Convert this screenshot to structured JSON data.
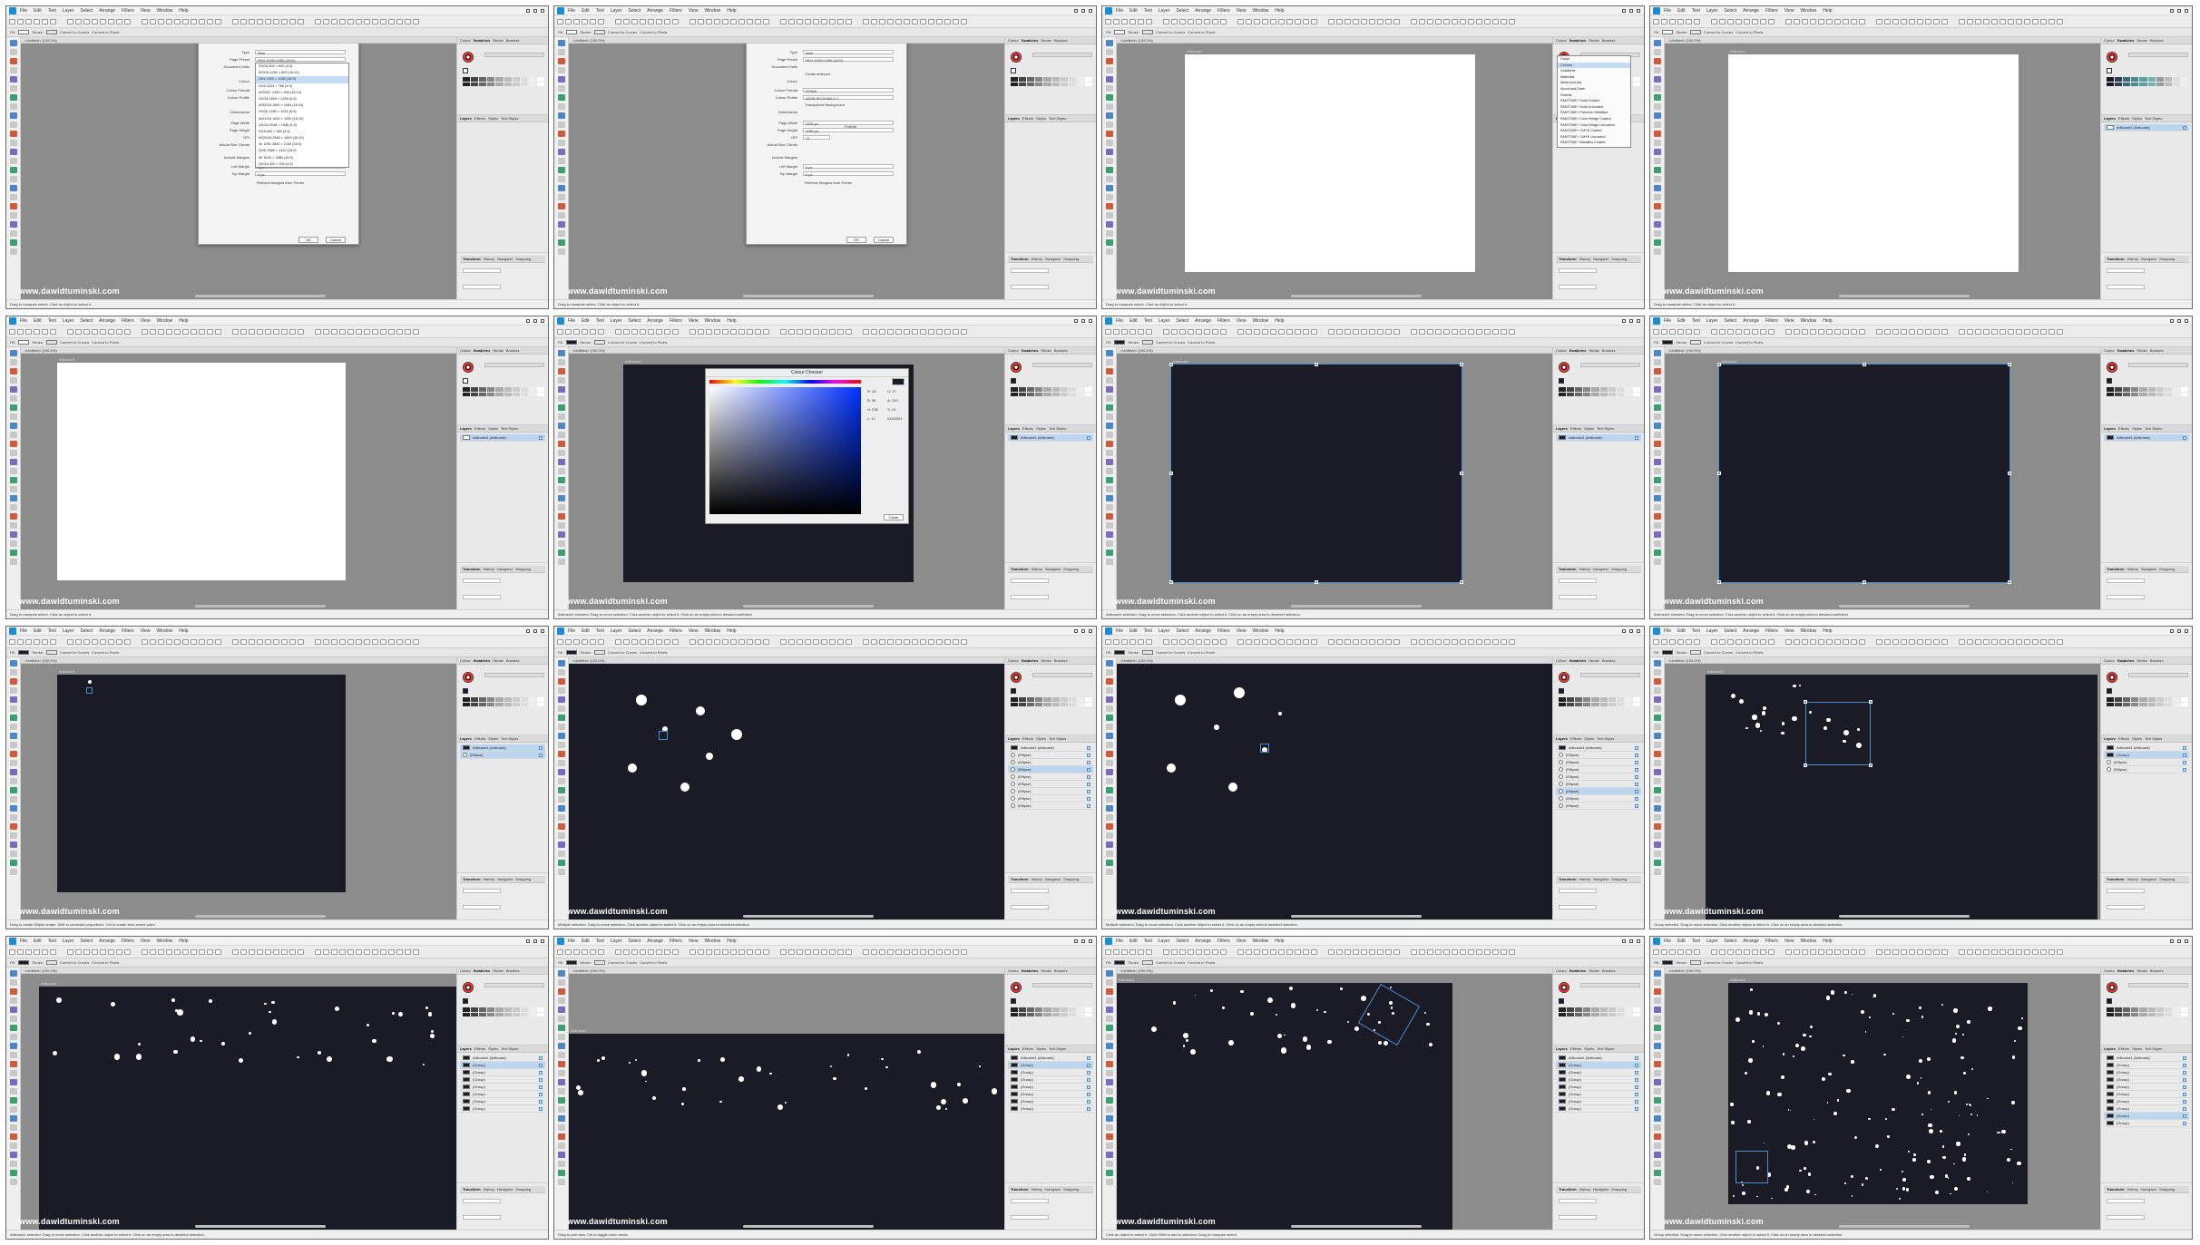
{
  "app": {
    "menus": [
      "File",
      "Edit",
      "Text",
      "Layer",
      "Select",
      "Arrange",
      "Filters",
      "View",
      "Window",
      "Help"
    ],
    "watermark": "www.dawidtuminski.com",
    "document_tab": "<Untitled> (100.0%)",
    "artboard_label": "Artboard1",
    "panel_tabs": [
      "Colour",
      "Swatches",
      "Stroke",
      "Brushes"
    ],
    "layers_tabs": [
      "Layers",
      "Effects",
      "Styles",
      "Text Styles"
    ],
    "transform_tabs": [
      "Transform",
      "History",
      "Navigator",
      "Snapping"
    ]
  },
  "colors": {
    "artboard_dark": "#1a1b24",
    "selection": "#4a8bd1",
    "canvas_bg": "#8c8c8c"
  },
  "new_document_dialog": {
    "title": "New Document",
    "labels": {
      "type": "Type",
      "page_preset": "Page Preset",
      "document_units": "Document Units",
      "colour": "Colour",
      "colour_format": "Colour Format",
      "colour_profile": "Colour Profile",
      "dimensions": "Dimensions",
      "page_width": "Page Width",
      "page_height": "Page Height",
      "dpi": "DPI",
      "about_size": "Actual Size Clients",
      "margins": "Include Margins",
      "left_margin": "Left Margin",
      "right_margin": "Right Margin",
      "top_margin": "Top Margin",
      "bottom_margin": "Bottom Margin",
      "retrieve": "Retrieve Margins from Printer",
      "create_artboard": "Create artboard",
      "transparent": "Transparent Background",
      "portrait": "Portrait"
    },
    "values": {
      "type": "Web",
      "page_preset": "HD4 1920×1080 (16:9)",
      "colour_format": "RGB/8",
      "colour_profile": "sRGB IEC61966-2.1",
      "page_width": "1920 px",
      "page_height": "1080 px",
      "dpi": "72",
      "margin": "0 px"
    },
    "preset_list": [
      "SVGA 800 × 600 (4:3)",
      "WXGA 1280 × 800 (16:10)",
      "HD4 1920 × 1080 (16:9)",
      "XGA 1024 × 768 (4:3)",
      "WXGA+ 1440 × 900 (16:10)",
      "UXGA 1600 × 1200 (4:3)",
      "WSXGA 1680 × 1050 (16:10)",
      "SXGA 1280 × 1024 (5:4)",
      "WUXGA 1920 × 1200 (16:10)",
      "QXGA 2048 × 1536 (4:3)",
      "VGA 640 × 480 (4:3)",
      "WQXGA 2560 × 1600 (16:10)",
      "4K UHD 3840 × 2160 (16:9)",
      "QHD 2560 × 1440 (16:9)",
      "5K 5120 × 2880 (16:9)",
      "QVGA 320 × 240 (4:3)"
    ],
    "ok": "OK",
    "cancel": "Cancel"
  },
  "colour_picker": {
    "title": "Colour Chooser",
    "mode": "RGB",
    "fields": [
      "R: 26",
      "G: 27",
      "B: 36",
      "A: 100",
      "H: 235",
      "S: 14",
      "L: 12",
      "#1A1B24"
    ],
    "close": "Close"
  },
  "swatch_popup": {
    "items": [
      "Greys",
      "Colours",
      "Gradients",
      "Materials",
      "Metal and sky",
      "Wood and Earth",
      "Pastels",
      "PANTONE+ Solid Coated",
      "PANTONE+ Solid Uncoated",
      "PANTONE+ Premium Metallics",
      "PANTONE+ Color Bridge Coated",
      "PANTONE+ Color Bridge Uncoated",
      "PANTONE+ CMYK Coated",
      "PANTONE+ CMYK Uncoated",
      "PANTONE+ Metallics Coated"
    ]
  },
  "layers": {
    "artboard": "Artboard1 (Artboard)",
    "ellipse": "(Ellipse)",
    "group": "(Group)"
  },
  "context": {
    "fill": "Fill:",
    "stroke": "Stroke:",
    "convert_curves": "Convert to Curves",
    "convert_pixels": "Convert to Pixels"
  },
  "status": [
    "Drag to marquee select. Click an object to select it.",
    "Drag to marquee select. Click an object to select it.",
    "Drag to marquee select. Click an object to select it.",
    "Drag to marquee select. Click an object to select it.",
    "Drag to marquee select. Click an object to select it.",
    "Artboard1 selected. Drag to move selection. Click another object to select it. Click on an empty area to deselect selection.",
    "Artboard1 selected. Drag to move selection. Click another object to select it. Click on an empty area to deselect selection.",
    "Artboard1 selected. Drag to move selection. Click another object to select it. Click on an empty area to deselect selection.",
    "Drag to create Ellipse shape. Shift to constrain proportions. Ctrl to create from centre point.",
    "Multiple selection. Drag to move selection. Click another object to select it. Click on an empty area to deselect selection.",
    "Multiple selection. Drag to move selection. Click another object to select it. Click on an empty area to deselect selection.",
    "Group selected. Drag to move selection. Click another object to select it. Click on an empty area to deselect selection.",
    "Artboard1 selected. Drag to move selection. Click another object to select it. Click on an empty area to deselect selection.",
    "Drag to pan view. Ctrl to toggle zoom mode.",
    "Click an object to select it. Click+Shift to add to selection. Drag to marquee select.",
    "Group selected. Drag to move selection. Click another object to select it. Click on an empty area to deselect selection."
  ]
}
